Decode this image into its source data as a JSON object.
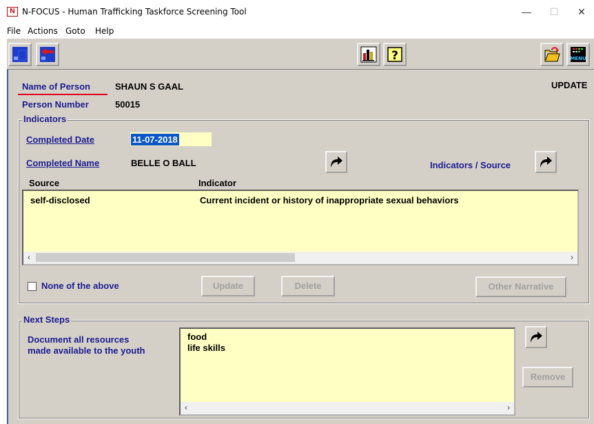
{
  "window": {
    "app_icon_letter": "N",
    "title": "N-FOCUS - Human Trafficking Taskforce Screening Tool",
    "minimize": "—",
    "maximize": "☐",
    "close": "✕"
  },
  "menu": [
    "File",
    "Actions",
    "Goto",
    "Help"
  ],
  "toolbar": {
    "icons": [
      "save-exit-icon",
      "back-icon",
      "chart-icon",
      "help-icon",
      "open-folder-icon",
      "menu-icon"
    ],
    "menu_icon_text": "MENU"
  },
  "person": {
    "name_label": "Name of Person",
    "name_value": "SHAUN S GAAL",
    "number_label": "Person Number",
    "number_value": "50015",
    "mode": "UPDATE"
  },
  "indicators": {
    "group_title": "Indicators",
    "completed_date_label": "Completed Date",
    "completed_date_value": "11-07-2018",
    "completed_name_label": "Completed Name",
    "completed_name_value": "BELLE O BALL",
    "indicators_source_label": "Indicators / Source",
    "columns": [
      "Source",
      "Indicator"
    ],
    "rows": [
      {
        "source": "self-disclosed",
        "indicator": "Current incident or history of inappropriate sexual behaviors"
      }
    ],
    "none_label": "None of the above",
    "none_checked": false,
    "update_label": "Update",
    "delete_label": "Delete",
    "other_narrative_label": "Other Narrative"
  },
  "next_steps": {
    "group_title": "Next Steps",
    "prompt_line1": "Document all resources",
    "prompt_line2": "made available to the youth",
    "items": [
      "food",
      "life skills"
    ],
    "remove_label": "Remove"
  },
  "colors": {
    "window_bg": "#d4d0c8",
    "list_bg": "#ffffc4",
    "link": "#1b1b8f",
    "selection": "#0a56c8",
    "underline_red": "#e0001a"
  }
}
